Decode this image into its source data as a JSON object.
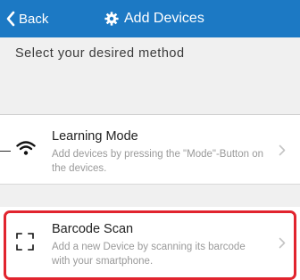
{
  "header": {
    "back_label": "Back",
    "title": "Add Devices",
    "background_color": "#1c79c4",
    "back_icon": "chevron-left-icon",
    "title_icon": "gear-icon"
  },
  "section": {
    "heading": "Select your desired method"
  },
  "methods": [
    {
      "title": "Learning Mode",
      "description": "Add devices by pressing the \"Mode\"-Button on the devices.",
      "icon": "wifi-icon"
    },
    {
      "title": "Barcode Scan",
      "description": "Add a new Device by scanning its barcode with your smartphone.",
      "icon": "scan-frame-icon",
      "highlighted": true
    }
  ],
  "highlight_color": "#e1242e"
}
